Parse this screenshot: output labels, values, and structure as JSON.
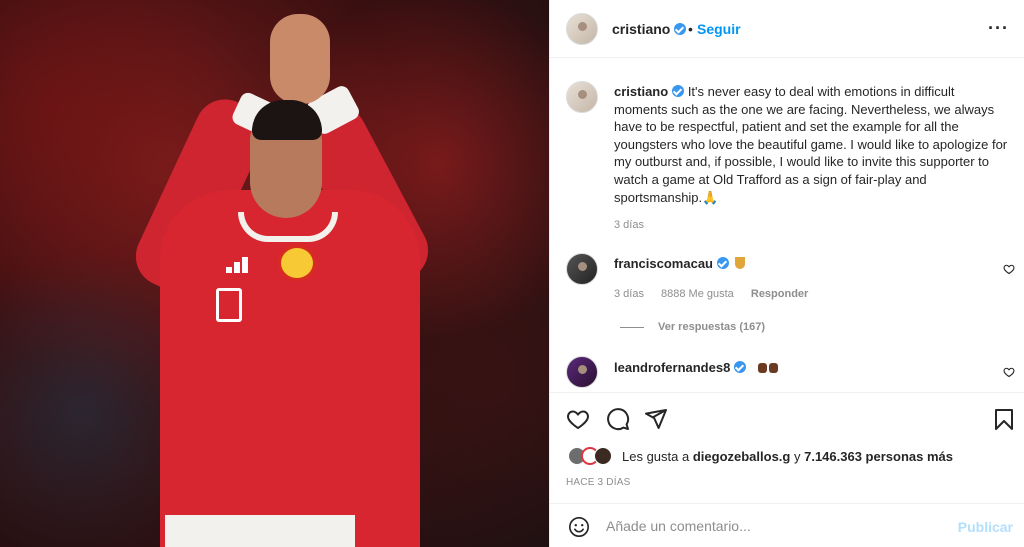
{
  "post": {
    "username": "cristiano",
    "follow_label": "Seguir",
    "separator": "•",
    "more_label": "···"
  },
  "caption": {
    "username": "cristiano",
    "text": "It's never easy to deal with emotions in difficult moments such as the one we are facing. Nevertheless, we always have to be respectful, patient and set the example for all the youngsters who love the beautiful game. I would like to apologize for my outburst and, if possible, I would like to invite this supporter to watch a game at Old Trafford as a sign of fair-play and sportsmanship.🙏",
    "time": "3 días"
  },
  "comments": [
    {
      "username": "franciscomacau",
      "emoji": "medal-icon",
      "time": "3 días",
      "likes": "8888 Me gusta",
      "reply_label": "Responder",
      "view_replies": "Ver respuestas (167)"
    },
    {
      "username": "leandrofernandes8",
      "emoji": "fists-icon"
    }
  ],
  "likes": {
    "prefix": "Les gusta a",
    "first_user": "diegozeballos.g",
    "suffix": "y",
    "others": "7.146.363 personas más"
  },
  "posted_time": "HACE 3 DÍAS",
  "comment_box": {
    "placeholder": "Añade un comentario...",
    "publish_label": "Publicar"
  },
  "colors": {
    "accent": "#0095f6",
    "publish_disabled": "#b2dffc",
    "verified": "#3897f0",
    "jersey_red": "#d7262f"
  }
}
